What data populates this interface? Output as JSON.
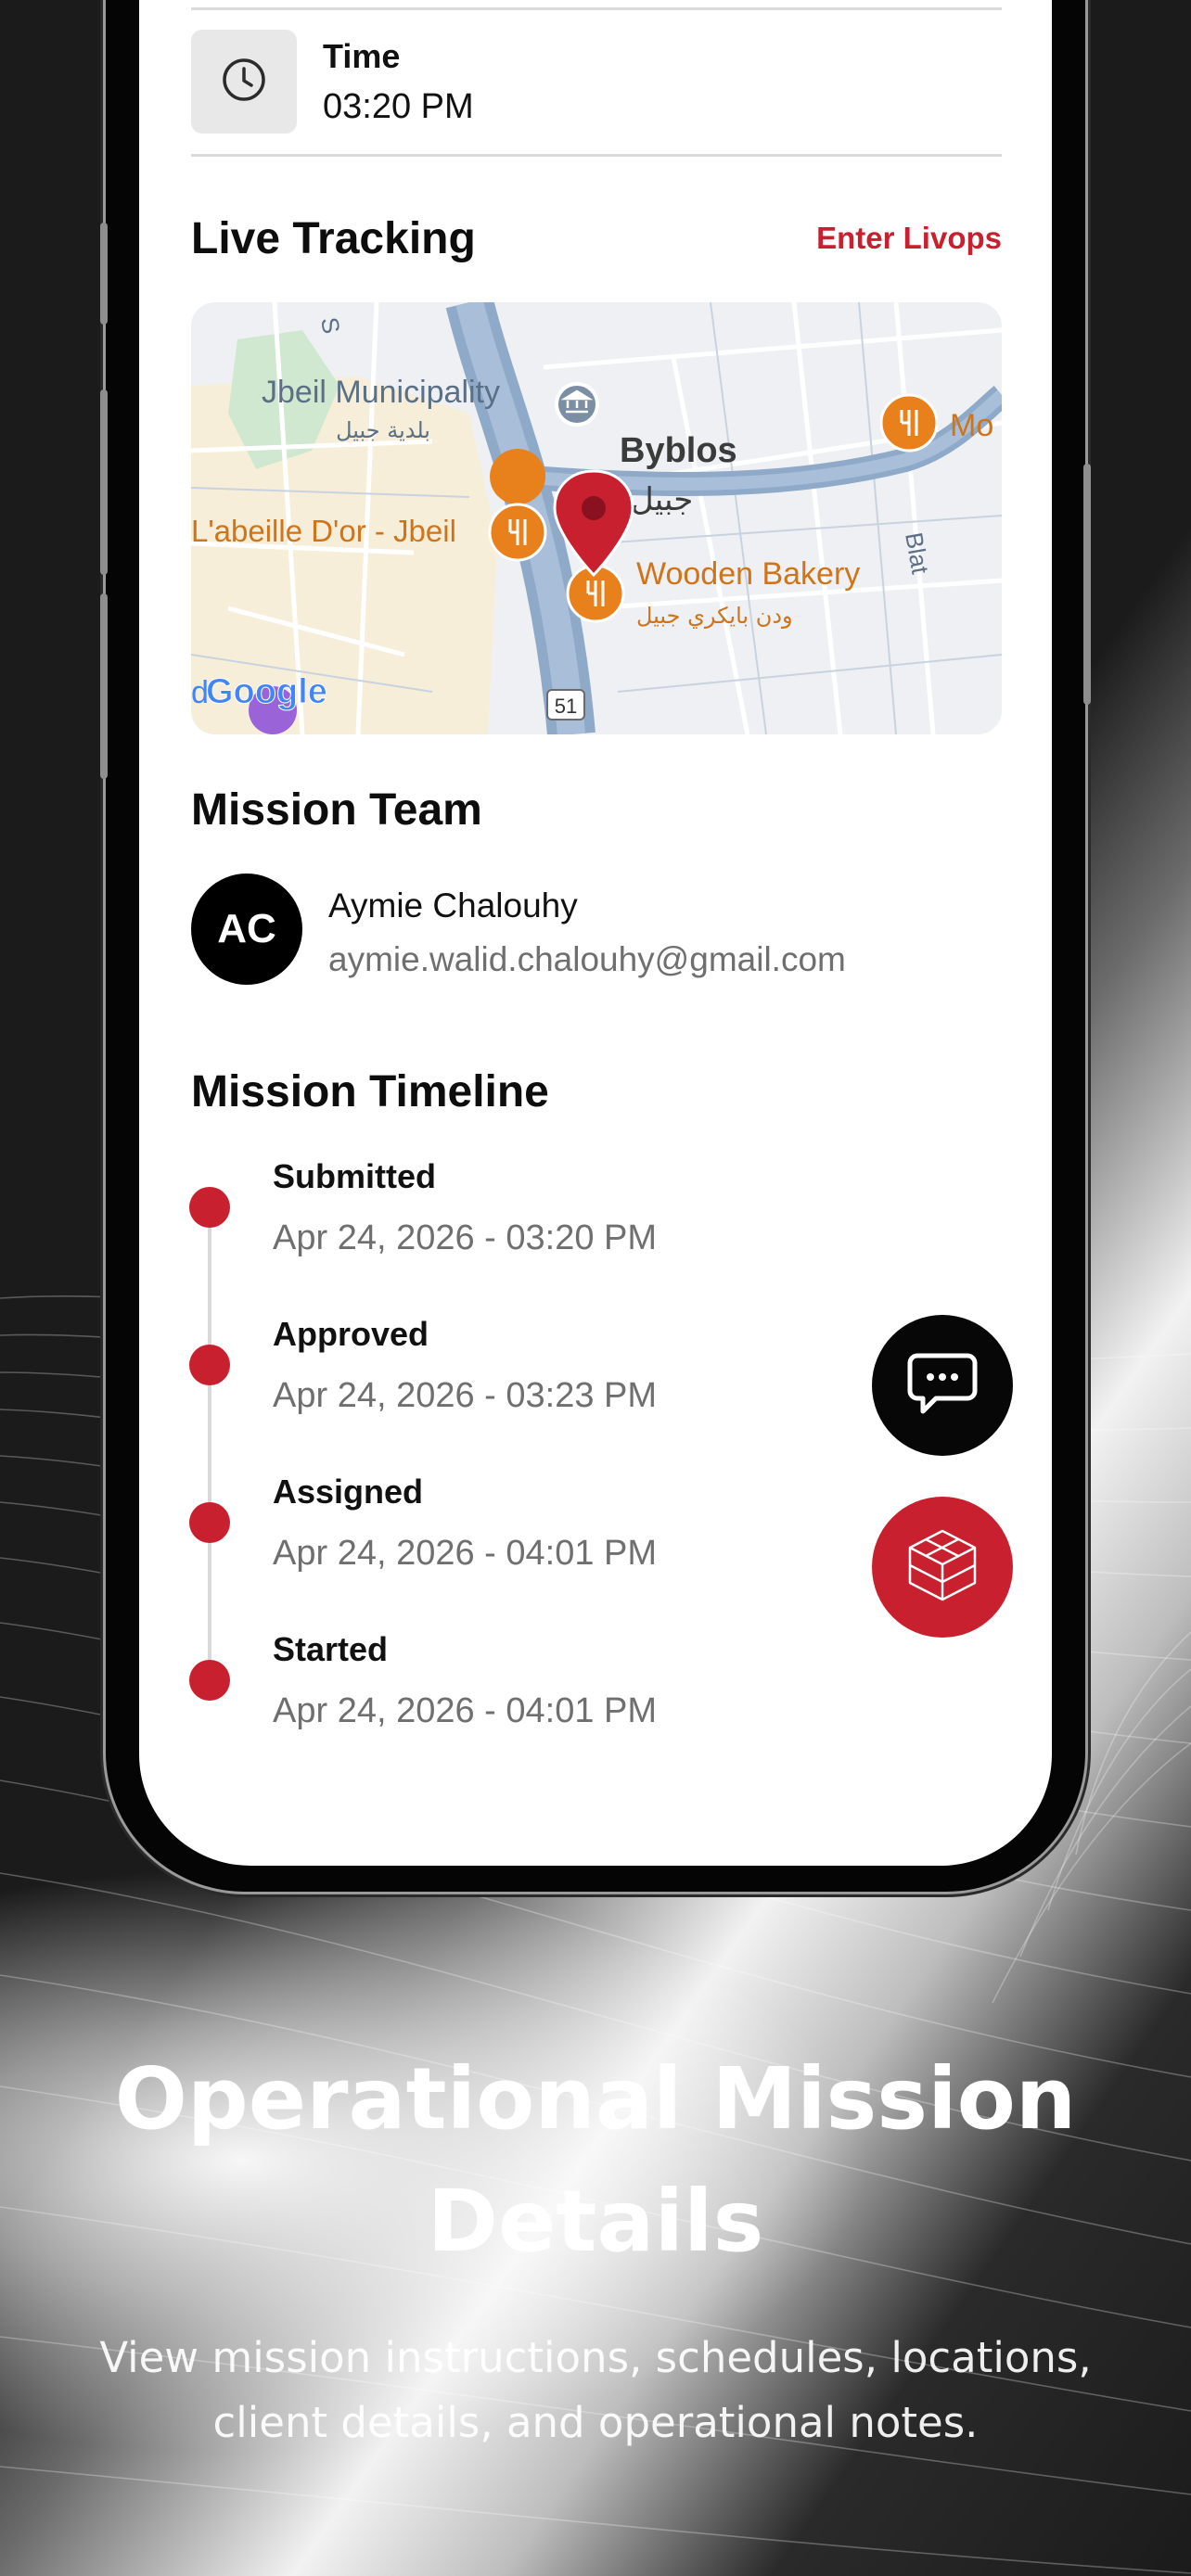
{
  "time_row": {
    "icon": "clock-icon",
    "label": "Time",
    "value": "03:20 PM"
  },
  "live_tracking": {
    "title": "Live Tracking",
    "action": "Enter Livops",
    "map": {
      "labels": {
        "municipality": "Jbeil Municipality",
        "municipality_ar": "بلدية جبيل",
        "city": "Byblos",
        "city_ar": "جبيل",
        "restaurant_1": "L'abeille D'or - Jbeil",
        "bakery": "Wooden Bakery",
        "bakery_ar": "ودن بايكري جبيل",
        "poi_right": "Mo",
        "road_right": "Blat",
        "highway": "51",
        "road_top": "S",
        "google": "Google",
        "left_edge": "d"
      },
      "pin_color": "#c8202f",
      "poi_color": "#e8801c"
    }
  },
  "mission_team": {
    "title": "Mission Team",
    "members": [
      {
        "initials": "AC",
        "name": "Aymie Chalouhy",
        "email": "aymie.walid.chalouhy@gmail.com"
      }
    ]
  },
  "mission_timeline": {
    "title": "Mission Timeline",
    "events": [
      {
        "status": "Submitted",
        "date": "Apr 24, 2026 - 03:20 PM"
      },
      {
        "status": "Approved",
        "date": "Apr 24, 2026 - 03:23 PM"
      },
      {
        "status": "Assigned",
        "date": "Apr 24, 2026 - 04:01 PM"
      },
      {
        "status": "Started",
        "date": "Apr 24, 2026 - 04:01 PM"
      }
    ]
  },
  "fabs": {
    "chat_icon": "chat-icon",
    "box_icon": "box-3d-icon"
  },
  "marketing": {
    "headline_line1": "Operational Mission",
    "headline_line2": "Details",
    "subtext_line1": "View mission instructions, schedules, locations,",
    "subtext_line2": "client details, and operational notes."
  },
  "colors": {
    "accent": "#c8202f",
    "text": "#111111",
    "muted": "#6f6f6f"
  }
}
